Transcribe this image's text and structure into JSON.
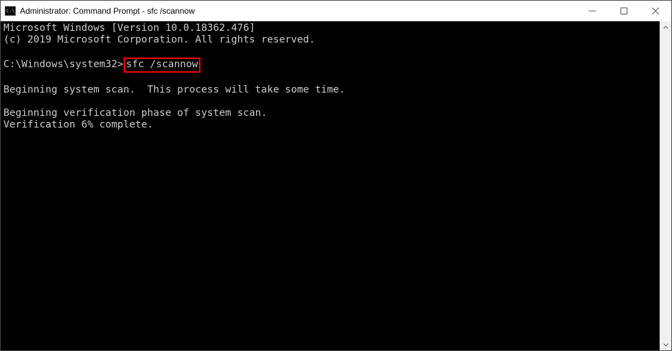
{
  "window": {
    "title": "Administrator: Command Prompt - sfc  /scannow"
  },
  "terminal": {
    "line1": "Microsoft Windows [Version 10.0.18362.476]",
    "line2": "(c) 2019 Microsoft Corporation. All rights reserved.",
    "blank1": "",
    "prompt_prefix": "C:\\Windows\\system32>",
    "command": "sfc /scannow",
    "blank2": "",
    "line3": "Beginning system scan.  This process will take some time.",
    "blank3": "",
    "line4": "Beginning verification phase of system scan.",
    "line5": "Verification 6% complete."
  }
}
